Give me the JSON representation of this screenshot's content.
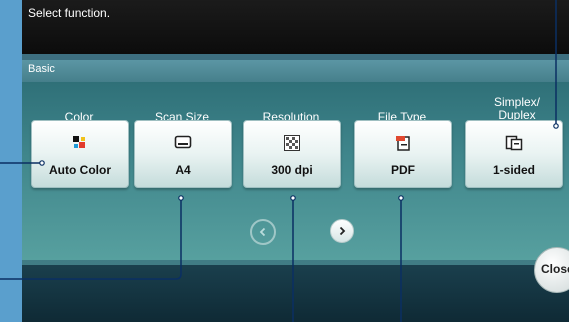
{
  "header": {
    "title": "Select function."
  },
  "section": {
    "label": "Basic"
  },
  "functions": [
    {
      "label": "Color",
      "value": "Auto Color",
      "icon": "color-squares-icon"
    },
    {
      "label": "Scan Size",
      "value": "A4",
      "icon": "scan-size-icon"
    },
    {
      "label": "Resolution",
      "value": "300 dpi",
      "icon": "resolution-checker-icon"
    },
    {
      "label": "File Type",
      "value": "PDF",
      "icon": "pdf-file-icon"
    },
    {
      "label_line1": "Simplex/",
      "label_line2": "Duplex",
      "value": "1-sided",
      "icon": "simplex-duplex-icon"
    }
  ],
  "navigation": {
    "prev_icon": "chevron-left-icon",
    "next_icon": "chevron-right-icon"
  },
  "close": {
    "label": "Close"
  },
  "colors": {
    "page_background": "#5a9fcd",
    "header": "#111111",
    "panel": "#3c7780",
    "button": "#e9f3f2"
  }
}
